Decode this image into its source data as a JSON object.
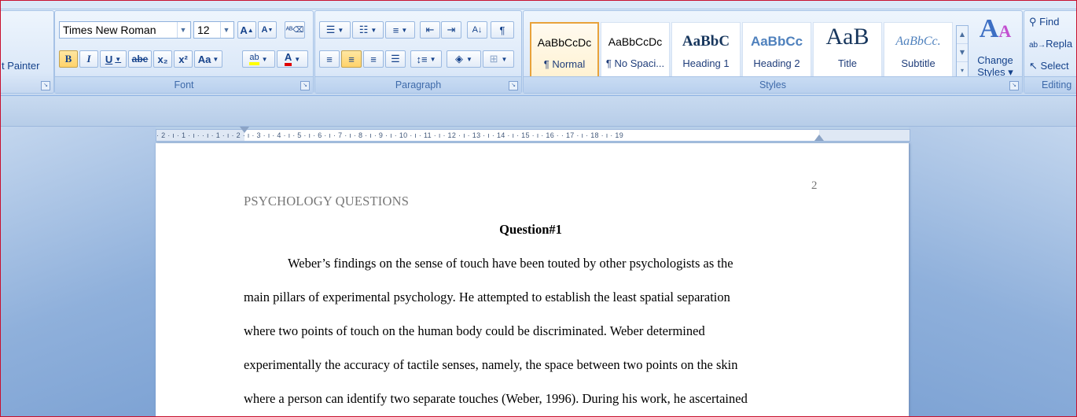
{
  "ribbon": {
    "clipboard": {
      "format_painter_label": "t Painter"
    },
    "font": {
      "group_label": "Font",
      "font_name": "Times New Roman",
      "font_size": "12",
      "grow_font": "A",
      "shrink_font": "A",
      "bold": "B",
      "italic": "I",
      "underline": "U",
      "strikethrough": "abe",
      "subscript": "x₂",
      "superscript": "x²",
      "change_case": "Aa",
      "highlight": "ab",
      "font_color": "A"
    },
    "paragraph": {
      "group_label": "Paragraph",
      "pilcrow": "¶"
    },
    "styles": {
      "group_label": "Styles",
      "items": [
        {
          "sample": "AaBbCcDc",
          "name": "¶ Normal",
          "selected": true
        },
        {
          "sample": "AaBbCcDc",
          "name": "¶ No Spaci...",
          "selected": false
        },
        {
          "sample": "AaBbC",
          "name": "Heading 1",
          "selected": false
        },
        {
          "sample": "AaBbCc",
          "name": "Heading 2",
          "selected": false
        },
        {
          "sample": "AaB",
          "name": "Title",
          "selected": false
        },
        {
          "sample": "AaBbCc.",
          "name": "Subtitle",
          "selected": false
        }
      ],
      "change_styles_line1": "Change",
      "change_styles_line2": "Styles ▾"
    },
    "editing": {
      "group_label": "Editing",
      "find": "Find",
      "replace": "Repla",
      "select": "Select"
    }
  },
  "ruler": {
    "text": "· 2 · ı · 1 · ı ·  · ı · 1 · ı · 2 · ı · 3 · ı · 4 · ı · 5 · ı · 6 · ı · 7 · ı · 8 · ı · 9 · ı · 10 · ı · 11 · ı · 12 · ı · 13 · ı · 14 · ı · 15 · ı · 16 ·  · 17 · ı · 18 · ı · 19"
  },
  "document": {
    "page_number": "2",
    "running_head": "PSYCHOLOGY QUESTIONS",
    "question_title": "Question#1",
    "lines": [
      "Weber’s findings on the sense of touch have been touted by other psychologists as the",
      "main pillars of experimental psychology. He attempted to establish the least spatial separation",
      "where two points of touch on the human body could be discriminated. Weber determined",
      "experimentally the accuracy of tactile senses, namely, the space between two points on the skin",
      "where a person can identify two separate touches (Weber, 1996). During his work, he ascertained"
    ]
  }
}
